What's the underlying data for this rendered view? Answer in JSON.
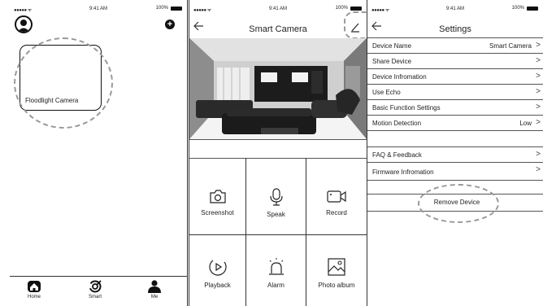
{
  "status": {
    "signal": "●●●●● ᯤ",
    "time": "9:41 AM",
    "battery": "100%"
  },
  "home": {
    "card_label": "Floodlight Camera",
    "add_symbol": "+",
    "tabs": [
      {
        "label": "Home",
        "icon": "home-icon"
      },
      {
        "label": "Smart",
        "icon": "smart-icon"
      },
      {
        "label": "Me",
        "icon": "person-icon"
      }
    ]
  },
  "camera": {
    "title": "Smart Camera",
    "actions": [
      {
        "label": "Screenshot",
        "icon": "camera-icon"
      },
      {
        "label": "Speak",
        "icon": "microphone-icon"
      },
      {
        "label": "Record",
        "icon": "video-icon"
      },
      {
        "label": "Playback",
        "icon": "play-icon"
      },
      {
        "label": "Alarm",
        "icon": "alarm-icon"
      },
      {
        "label": "Photo album",
        "icon": "image-icon"
      }
    ]
  },
  "settings": {
    "title": "Settings",
    "rows": [
      {
        "label": "Device Name",
        "value": "Smart Camera"
      },
      {
        "label": "Share Device",
        "value": ""
      },
      {
        "label": "Device Infromation",
        "value": ""
      },
      {
        "label": "Use Echo",
        "value": ""
      },
      {
        "label": "Basic Function Settings",
        "value": ""
      },
      {
        "label": "Motion Detection",
        "value": "Low"
      },
      {
        "label": "FAQ & Feedback",
        "value": ""
      },
      {
        "label": "Firmware Infromation",
        "value": ""
      }
    ],
    "remove_label": "Remove Device"
  },
  "colors": {
    "foreground": "#111111",
    "dashed_highlight": "#999999",
    "background": "#ffffff"
  }
}
